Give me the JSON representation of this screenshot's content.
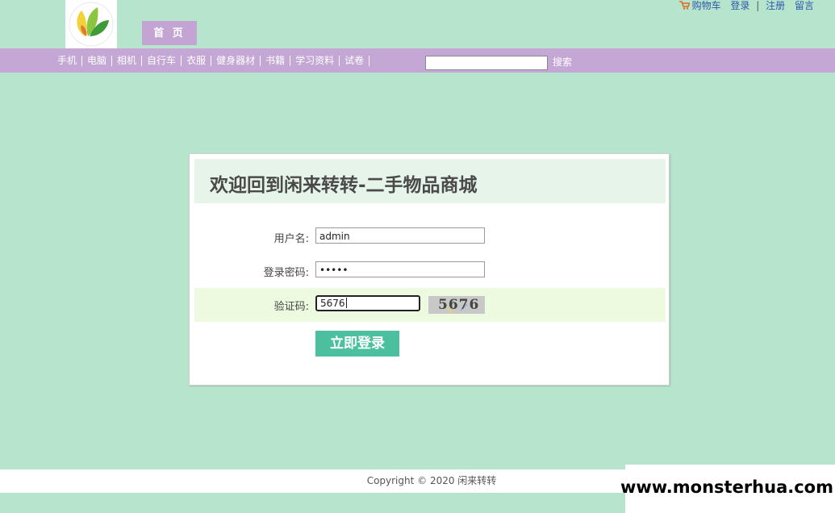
{
  "header": {
    "home_tab": "首 页",
    "top_links": {
      "cart": "购物车",
      "login": "登录",
      "register": "注册",
      "message": "留言",
      "separator": "|"
    }
  },
  "nav": {
    "items": [
      "手机",
      "电脑",
      "相机",
      "自行车",
      "衣服",
      "健身器材",
      "书籍",
      "学习资料",
      "试卷"
    ],
    "search_value": "",
    "search_button": "搜索"
  },
  "login": {
    "title": "欢迎回到闲来转转-二手物品商城",
    "username_label": "用户名:",
    "username_value": "admin",
    "password_label": "登录密码:",
    "password_value": "•••••",
    "captcha_label": "验证码:",
    "captcha_value": "5676",
    "captcha_image_text": "5676",
    "submit_button": "立即登录"
  },
  "footer": {
    "copyright": "Copyright © 2020 闲来转转"
  },
  "watermark": "www.monsterhua.com",
  "colors": {
    "background": "#b7e4cd",
    "nav_bar": "#c4a7d4",
    "home_tab": "#c3a4d2",
    "login_header": "#e6f4e9",
    "captcha_row": "#eefadf",
    "login_button": "#4cbf9e",
    "link": "#2e5aa8"
  }
}
